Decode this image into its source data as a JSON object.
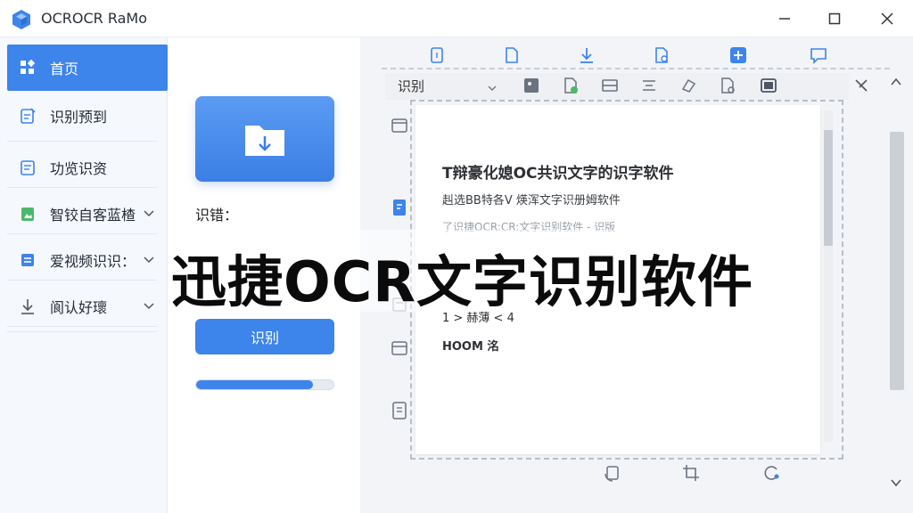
{
  "window": {
    "title": "OCROCR RaMo",
    "controls": {
      "minimize": "—",
      "maximize": "☐",
      "close": "✕"
    }
  },
  "sidebar": {
    "items": [
      {
        "label": "首页",
        "icon": "grid-icon",
        "active": true
      },
      {
        "label": "识别预到",
        "icon": "edit-doc-icon"
      },
      {
        "label": "功览识资",
        "icon": "doc-icon"
      },
      {
        "label": "智铰自客蓝楂",
        "icon": "image-doc-icon",
        "expandable": true
      },
      {
        "label": "爱视频识识：",
        "icon": "list-doc-icon",
        "expandable": true
      },
      {
        "label": "阆认好瓌",
        "icon": "download-icon",
        "expandable": true
      }
    ]
  },
  "main": {
    "status_label": "识错：",
    "recognize_button": "识别",
    "progress": 0.85
  },
  "workspace": {
    "toolbar": {
      "select_value": "识别"
    },
    "document": {
      "lines": [
        "T辩豪化媳OC共识文字的识字软件",
        "赳选BB特各V 煐浑文字识册姆软件",
        "了识捷OCR:CR:文字识别软件 - 识版",
        "1 > 赫薄    < 4",
        "HOOM   洺"
      ]
    }
  },
  "overlay": {
    "title": "迅捷OCR文字识别软件"
  },
  "colors": {
    "accent": "#3d84eb",
    "sidebar_bg": "#f5f8fd",
    "workspace_bg": "#f2f4f7"
  }
}
